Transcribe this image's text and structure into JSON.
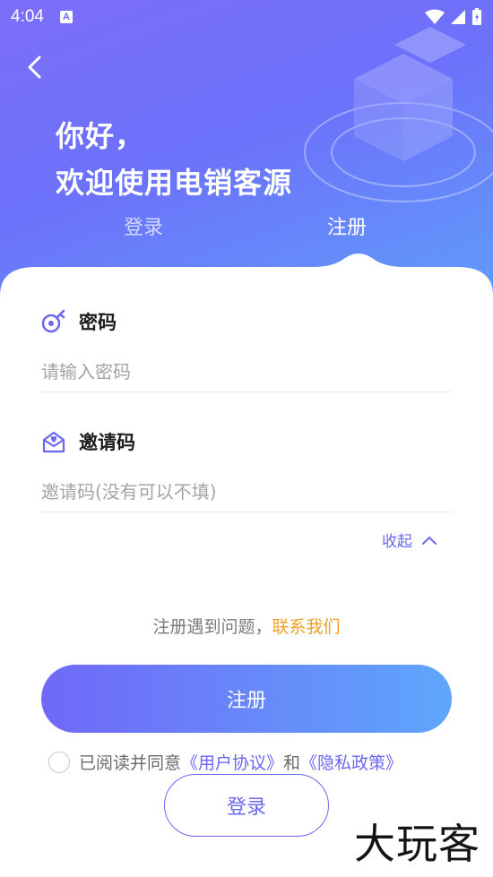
{
  "status_bar": {
    "time": "4:04",
    "notification_letter": "A"
  },
  "header": {
    "greeting_line1": "你好，",
    "greeting_line2": "欢迎使用电销客源"
  },
  "tabs": [
    {
      "label": "登录",
      "active": false
    },
    {
      "label": "注册",
      "active": true
    }
  ],
  "form": {
    "password": {
      "label": "密码",
      "placeholder": "请输入密码",
      "value": ""
    },
    "invite_code": {
      "label": "邀请码",
      "placeholder": "邀请码(没有可以不填)",
      "value": ""
    },
    "collapse_label": "收起"
  },
  "help": {
    "text": "注册遇到问题，",
    "link": "联系我们"
  },
  "register_button": "注册",
  "agreement": {
    "checked": false,
    "prefix": "已阅读并同意",
    "user_agreement": "《用户协议》",
    "and": "和",
    "privacy_policy": "《隐私政策》"
  },
  "login_button": "登录",
  "watermark": "大玩客",
  "colors": {
    "accent": "#6b68f0",
    "gradient_start": "#7068f8",
    "gradient_end": "#5fa6fc",
    "link_orange": "#f0a028"
  },
  "icons": {
    "password": "key-icon",
    "invite_code": "envelope-heart-icon",
    "back": "chevron-left-icon",
    "collapse": "chevron-up-icon"
  }
}
